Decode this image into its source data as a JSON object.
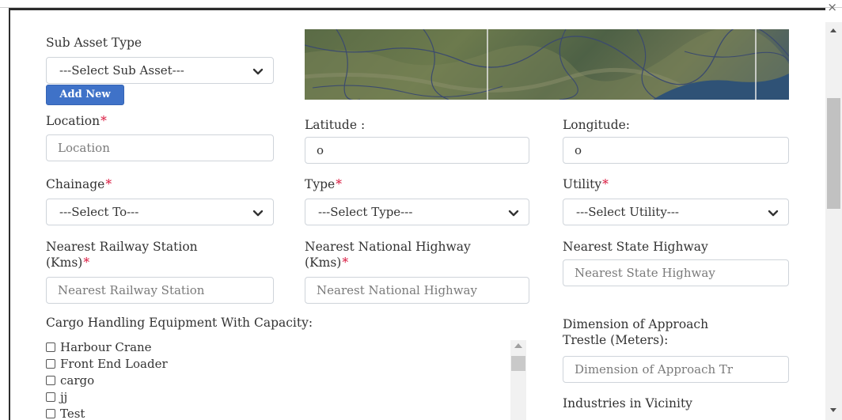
{
  "window": {
    "close_glyph": "×"
  },
  "sub_asset": {
    "label": "Sub Asset Type",
    "select_value": "---Select Sub Asset---",
    "add_new": "Add New"
  },
  "location": {
    "label": "Location",
    "required_mark": "*",
    "placeholder": "Location"
  },
  "latitude": {
    "label": "Latitude :",
    "value": "o"
  },
  "longitude": {
    "label": "Longitude:",
    "value": "o"
  },
  "chainage": {
    "label": "Chainage",
    "required_mark": "*",
    "select_value": "---Select To---"
  },
  "type": {
    "label": "Type",
    "required_mark": "*",
    "select_value": "---Select Type---"
  },
  "utility": {
    "label": "Utility",
    "required_mark": "*",
    "select_value": "---Select Utility---"
  },
  "railway": {
    "label_line1": "Nearest Railway Station",
    "label_line2": "(Kms)",
    "required_mark": "*",
    "placeholder": "Nearest Railway Station"
  },
  "national_highway": {
    "label_line1": "Nearest National Highway",
    "label_line2": "(Kms)",
    "required_mark": "*",
    "placeholder": "Nearest National Highway"
  },
  "state_highway": {
    "label": "Nearest State Highway",
    "placeholder": "Nearest State Highway"
  },
  "cargo": {
    "label": "Cargo Handling Equipment With Capacity:",
    "items": [
      "Harbour Crane",
      "Front End Loader",
      "cargo",
      "jj",
      "Test"
    ]
  },
  "trestle": {
    "label_line1": "Dimension of Approach",
    "label_line2": "Trestle (Meters):",
    "placeholder": "Dimension of Approach Tr"
  },
  "industries": {
    "label": "Industries in Vicinity"
  },
  "colors": {
    "accent": "#3f72c8",
    "required": "#d9163d"
  },
  "icons": [
    "close-icon",
    "chevron-down-icon",
    "checkbox-icon",
    "scroll-up-arrow-icon",
    "scroll-down-arrow-icon"
  ]
}
